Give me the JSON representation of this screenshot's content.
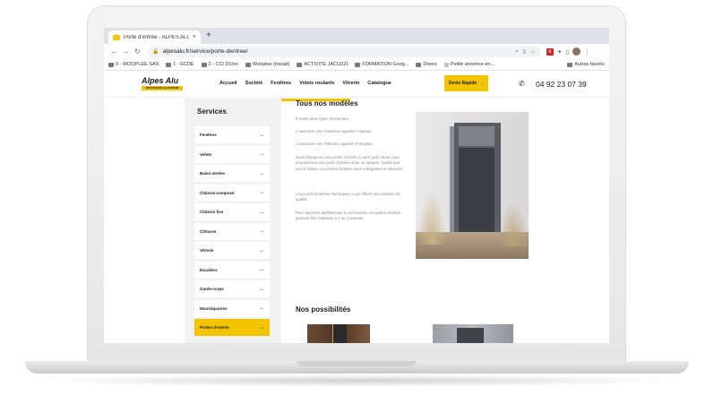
{
  "browser": {
    "tab_title": "Porte d'entrée - ALPES ALU | ...",
    "tab_close": "×",
    "new_tab": "+",
    "url": "alpesalu.fr/service/porte-dentree/",
    "bookmarks": [
      "0 - WOOPLEE SAS",
      "1 - ECDE",
      "2 - CCI DIJon",
      "Wooplee (travail)",
      "ACTIVITE JACUZZI",
      "FORMATION Goog...",
      "Divers",
      "Petite annonce en..."
    ],
    "bookmarks_right": "Autres favoris",
    "icons": [
      "back-icon",
      "forward-icon",
      "reload-icon",
      "lock-icon",
      "search-icon",
      "share-icon",
      "star-icon",
      "extensions-icon",
      "sidebar-icon",
      "profile-avatar",
      "menu-icon"
    ]
  },
  "site": {
    "logo_name": "Alpes Alu",
    "logo_tagline": "MENUISERIE ALUMINIUM",
    "nav": [
      "Accueil",
      "Société",
      "Fenêtres",
      "Volets roulants",
      "Vitrerie",
      "Catalogue"
    ],
    "cta_label": "Devis Rapide",
    "cta_arrow": "→",
    "phone": "04 92 23 07 39",
    "accent_color": "#f5c400"
  },
  "sidebar": {
    "title": "Services",
    "items": [
      {
        "label": "Fenêtres",
        "active": false
      },
      {
        "label": "Volets",
        "active": false
      },
      {
        "label": "Baies-vitrées",
        "active": false
      },
      {
        "label": "Châssis-composé",
        "active": false
      },
      {
        "label": "Châssis fixe",
        "active": false
      },
      {
        "label": "Clôtures",
        "active": false
      },
      {
        "label": "Vitrerie",
        "active": false
      },
      {
        "label": "Escaliers",
        "active": false
      },
      {
        "label": "Garde-corps",
        "active": false
      },
      {
        "label": "Moustiquaires",
        "active": false
      },
      {
        "label": "Portes d'entrée",
        "active": true
      }
    ],
    "arrow": "→"
  },
  "main": {
    "models_title": "Tous nos modèles",
    "paragraphs": [
      "Il existe deux types d'ouverture :",
      "L'ouverture vers l'extérieur appelée Anglaise.",
      "L'ouverture vers l'intérieur appelée Française.",
      "Nous fabriquons vos portes d'entrée à votre goût. Nous vous proposerons une porte d'entrée vitrée ou opaque. Quelle que soit la finition, vos portes d'entrée seront élégantes et robustes.",
      "Leurs performances thermiques, vous offrent une isolation de qualité.",
      "Pour répondre parfaitement à vos besoins, les portes d'entrée peuvent être réalisées à 1 ou 2 vantaux."
    ],
    "possibilities_title": "Nos possibilités"
  }
}
